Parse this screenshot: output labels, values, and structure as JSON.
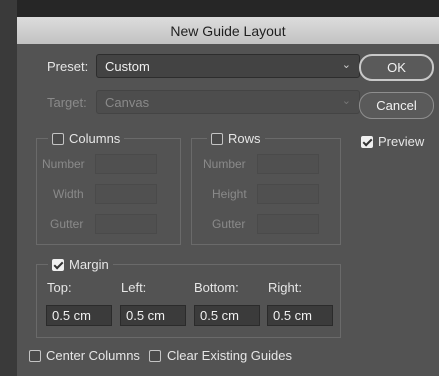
{
  "dialog": {
    "title": "New Guide Layout"
  },
  "preset": {
    "label": "Preset:",
    "value": "Custom"
  },
  "target": {
    "label": "Target:",
    "value": "Canvas"
  },
  "buttons": {
    "ok": "OK",
    "cancel": "Cancel"
  },
  "preview": {
    "label": "Preview",
    "checked": true
  },
  "columns": {
    "label": "Columns",
    "checked": false,
    "fields": {
      "number": "Number",
      "width": "Width",
      "gutter": "Gutter"
    }
  },
  "rows": {
    "label": "Rows",
    "checked": false,
    "fields": {
      "number": "Number",
      "height": "Height",
      "gutter": "Gutter"
    }
  },
  "margin": {
    "label": "Margin",
    "checked": true,
    "top_label": "Top:",
    "left_label": "Left:",
    "bottom_label": "Bottom:",
    "right_label": "Right:",
    "top": "0.5 cm",
    "left": "0.5 cm",
    "bottom": "0.5 cm",
    "right": "0.5 cm"
  },
  "options": {
    "center_columns": "Center Columns",
    "clear_guides": "Clear Existing Guides"
  },
  "colors": {
    "dialog_bg": "#535353",
    "title_bg": "#d0d0d0"
  }
}
